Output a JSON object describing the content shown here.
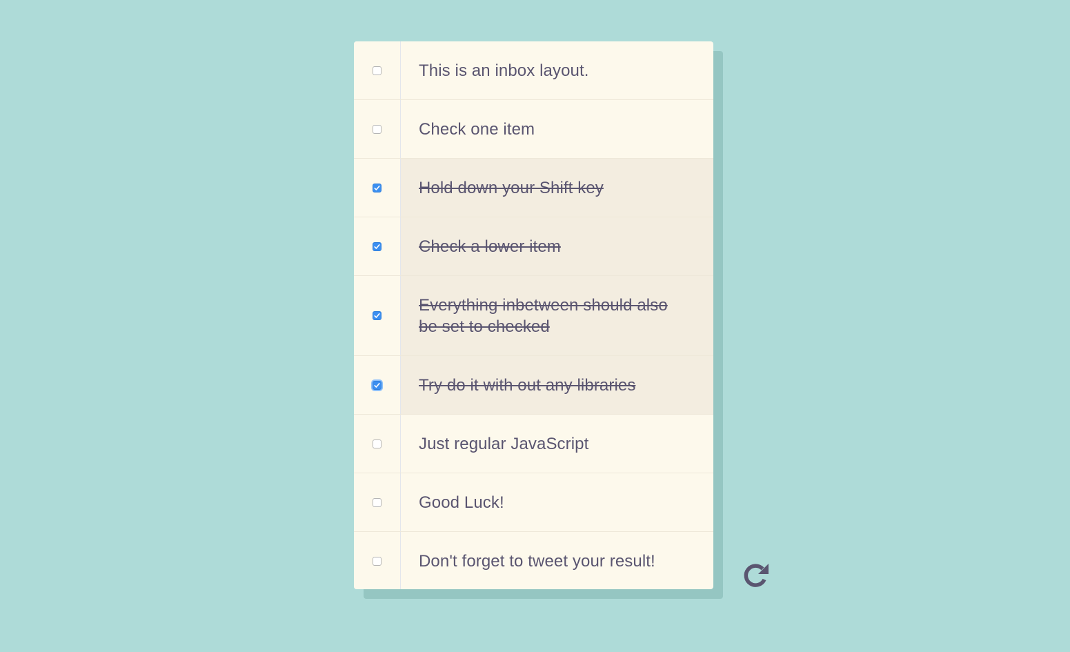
{
  "items": [
    {
      "label": "This is an inbox layout.",
      "checked": false
    },
    {
      "label": "Check one item",
      "checked": false
    },
    {
      "label": "Hold down your Shift key",
      "checked": true
    },
    {
      "label": "Check a lower item",
      "checked": true
    },
    {
      "label": "Everything inbetween should also be set to checked",
      "checked": true
    },
    {
      "label": "Try do it with out any libraries",
      "checked": true,
      "focused": true
    },
    {
      "label": "Just regular JavaScript",
      "checked": false
    },
    {
      "label": "Good Luck!",
      "checked": false
    },
    {
      "label": "Don't forget to tweet your result!",
      "checked": false
    }
  ],
  "reset": {
    "icon": "refresh-icon"
  },
  "colors": {
    "background": "#aedbd8",
    "panel": "#fdf9ec",
    "checked_row": "#f3ede0",
    "text": "#5a5570",
    "checkbox_checked": "#3b8ff0"
  }
}
